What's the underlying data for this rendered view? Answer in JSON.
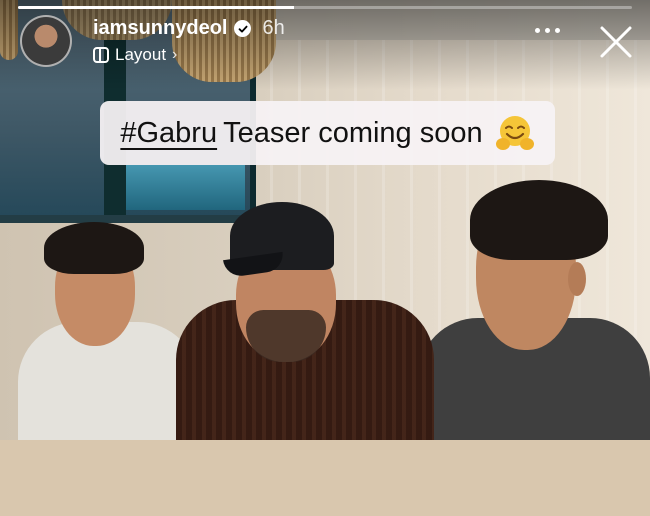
{
  "story": {
    "username": "iamsunnydeol",
    "time_ago": "6h",
    "subtitle": "Layout",
    "progress": 0.45,
    "caption": {
      "hashtag": "#Gabru",
      "text": "Teaser coming soon",
      "emoji": "hugging-face-emoji"
    }
  },
  "icons": {
    "verified": "verified-badge-icon",
    "layout": "layout-icon",
    "more": "more-options-icon",
    "close": "close-icon"
  },
  "colors": {
    "caption_bg": "#f6f2f4",
    "text_light": "#ffffff",
    "verified_bg": "#ffffff"
  }
}
